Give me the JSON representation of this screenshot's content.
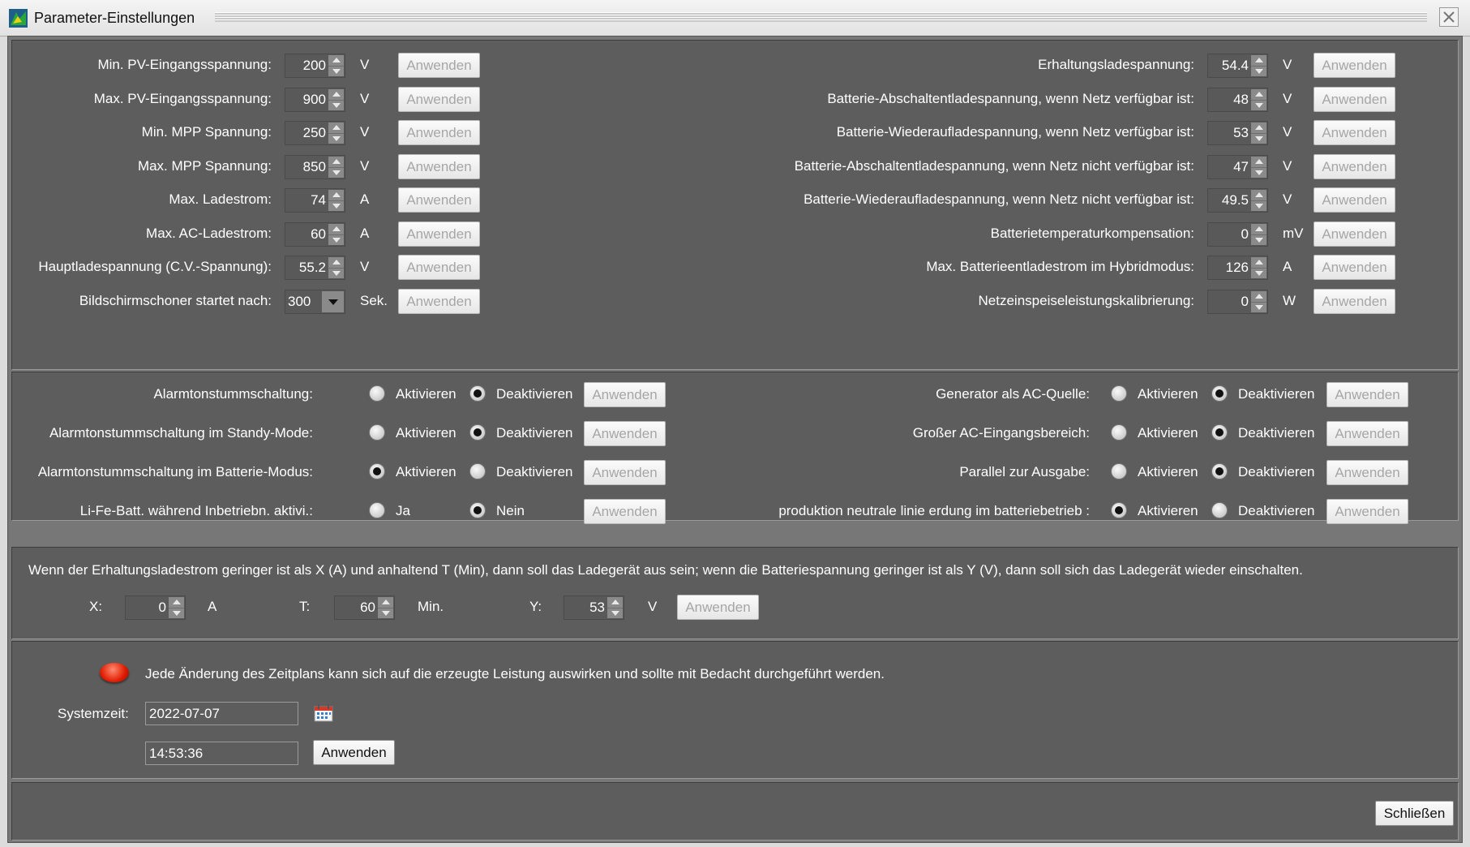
{
  "window": {
    "title": "Parameter-Einstellungen"
  },
  "section1": {
    "left": [
      {
        "label": "Min. PV-Eingangsspannung:",
        "value": "200",
        "unit": "V"
      },
      {
        "label": "Max. PV-Eingangsspannung:",
        "value": "900",
        "unit": "V"
      },
      {
        "label": "Min. MPP Spannung:",
        "value": "250",
        "unit": "V"
      },
      {
        "label": "Max. MPP Spannung:",
        "value": "850",
        "unit": "V"
      },
      {
        "label": "Max. Ladestrom:",
        "value": "74",
        "unit": "A"
      },
      {
        "label": "Max. AC-Ladestrom:",
        "value": "60",
        "unit": "A"
      },
      {
        "label": "Hauptladespannung (C.V.-Spannung):",
        "value": "55.2",
        "unit": "V"
      }
    ],
    "screensaver": {
      "label": "Bildschirmschoner startet nach:",
      "value": "300",
      "unit": "Sek."
    },
    "right": [
      {
        "label": "Erhaltungsladespannung:",
        "value": "54.4",
        "unit": "V"
      },
      {
        "label": "Batterie-Abschaltentladespannung, wenn Netz verfügbar ist:",
        "value": "48",
        "unit": "V"
      },
      {
        "label": "Batterie-Wiederaufladespannung, wenn Netz verfügbar ist:",
        "value": "53",
        "unit": "V"
      },
      {
        "label": "Batterie-Abschaltentladespannung, wenn Netz nicht verfügbar ist:",
        "value": "47",
        "unit": "V"
      },
      {
        "label": "Batterie-Wiederaufladespannung, wenn Netz nicht verfügbar ist:",
        "value": "49.5",
        "unit": "V"
      },
      {
        "label": "Batterietemperaturkompensation:",
        "value": "0",
        "unit": "mV"
      },
      {
        "label": "Max. Batterieentladestrom im Hybridmodus:",
        "value": "126",
        "unit": "A"
      },
      {
        "label": "Netzeinspeiseleistungskalibrierung:",
        "value": "0",
        "unit": "W"
      }
    ]
  },
  "section2": {
    "left": [
      {
        "label": "Alarmtonstummschaltung:",
        "opt1": "Aktivieren",
        "opt2": "Deaktivieren",
        "selected": 2
      },
      {
        "label": "Alarmtonstummschaltung im Standy-Mode:",
        "opt1": "Aktivieren",
        "opt2": "Deaktivieren",
        "selected": 2
      },
      {
        "label": "Alarmtonstummschaltung im Batterie-Modus:",
        "opt1": "Aktivieren",
        "opt2": "Deaktivieren",
        "selected": 1
      },
      {
        "label": "Li-Fe-Batt. während Inbetriebn. aktivi.:",
        "opt1": "Ja",
        "opt2": "Nein",
        "selected": 2
      }
    ],
    "right": [
      {
        "label": "Generator als AC-Quelle:",
        "opt1": "Aktivieren",
        "opt2": "Deaktivieren",
        "selected": 2
      },
      {
        "label": "Großer AC-Eingangsbereich:",
        "opt1": "Aktivieren",
        "opt2": "Deaktivieren",
        "selected": 2
      },
      {
        "label": "Parallel zur Ausgabe:",
        "opt1": "Aktivieren",
        "opt2": "Deaktivieren",
        "selected": 2
      },
      {
        "label": "produktion neutrale linie erdung im batteriebetrieb :",
        "opt1": "Aktivieren",
        "opt2": "Deaktivieren",
        "selected": 1
      }
    ]
  },
  "section3": {
    "description": "Wenn der Erhaltungsladestrom geringer ist als X (A) und anhaltend T (Min), dann soll das Ladegerät aus sein; wenn die Batteriespannung geringer ist als Y (V), dann soll sich das Ladegerät wieder einschalten.",
    "x": {
      "label": "X:",
      "value": "0",
      "unit": "A"
    },
    "t": {
      "label": "T:",
      "value": "60",
      "unit": "Min."
    },
    "y": {
      "label": "Y:",
      "value": "53",
      "unit": "V"
    }
  },
  "section4": {
    "warning": "Jede Änderung des Zeitplans kann sich auf die erzeugte Leistung auswirken und sollte mit Bedacht durchgeführt werden.",
    "systemtime_label": "Systemzeit:",
    "date": "2022-07-07",
    "time": "14:53:36"
  },
  "apply_label": "Anwenden",
  "close_label": "Schließen",
  "colors": {
    "panel": "#5d5d5d",
    "frame": "#777777",
    "warning": "#e01b00"
  },
  "icons": [
    "app-icon",
    "close-icon",
    "spin-up-icon",
    "spin-down-icon",
    "dropdown-icon",
    "warning-icon",
    "calendar-icon"
  ]
}
